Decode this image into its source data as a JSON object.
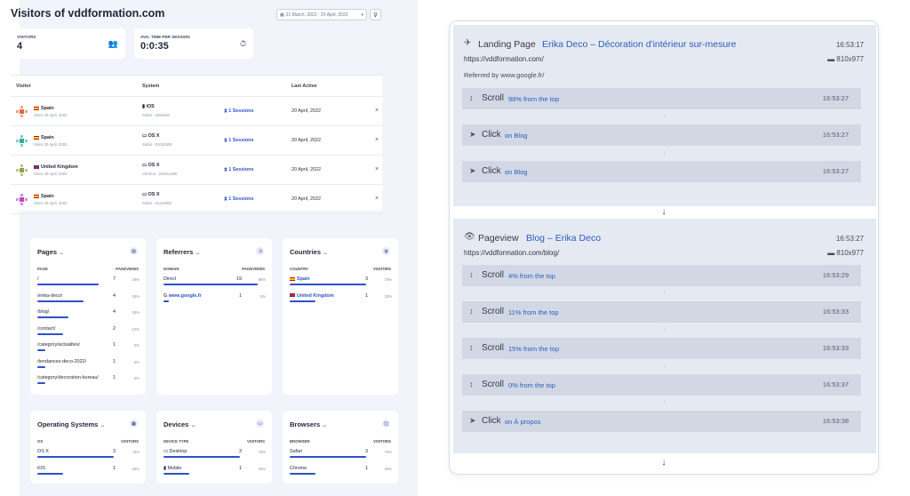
{
  "dashboard": {
    "title": "Visitors of vddformation.com",
    "date_range": "21 March, 2022 - 20 April, 2022",
    "stats": [
      {
        "label": "VISITORS",
        "value": "4",
        "icon": "users-icon"
      },
      {
        "label": "AVG. TIME PER SESSION",
        "value": "0:0:35",
        "icon": "stopwatch-icon"
      }
    ],
    "table": {
      "headers": [
        "Visitor",
        "System",
        "Last Active"
      ],
      "rows": [
        {
          "country": "Spain",
          "since": "Since 20 April, 2022",
          "os": "iOS",
          "browser": "Safari - 428x926",
          "sessions": "1 Sessions",
          "last_active": "20 April, 2022",
          "flag": "es",
          "avatar_color": "#e0673c"
        },
        {
          "country": "Spain",
          "since": "Since 20 April, 2022",
          "os": "OS X",
          "browser": "Safari - 810x1080",
          "sessions": "1 Sessions",
          "last_active": "20 April, 2022",
          "flag": "es",
          "avatar_color": "#2fae9e"
        },
        {
          "country": "United Kingdom",
          "since": "Since 20 April, 2022",
          "os": "OS X",
          "browser": "Chrome - 2240x1260",
          "sessions": "1 Sessions",
          "last_active": "20 April, 2022",
          "flag": "uk",
          "avatar_color": "#8aa04c"
        },
        {
          "country": "Spain",
          "since": "Since 20 April, 2022",
          "os": "OS X",
          "browser": "Safari - 1512x982",
          "sessions": "1 Sessions",
          "last_active": "20 April, 2022",
          "flag": "es",
          "avatar_color": "#c043c6"
        }
      ]
    },
    "panels": {
      "pages": {
        "title": "Pages",
        "col1": "PAGE",
        "col2": "PAGEVIEWS",
        "rows": [
          {
            "label": "/",
            "count": "7",
            "pct": "25%",
            "fill": 0.6
          },
          {
            "label": "/erika-deco/",
            "count": "4",
            "pct": "25%",
            "fill": 0.45
          },
          {
            "label": "/blog/",
            "count": "4",
            "pct": "25%",
            "fill": 0.3
          },
          {
            "label": "/contact/",
            "count": "2",
            "pct": "10%",
            "fill": 0.25
          },
          {
            "label": "/category/actualites/",
            "count": "1",
            "pct": "5%",
            "fill": 0.08
          },
          {
            "label": "/tendances-deco-2022/",
            "count": "1",
            "pct": "5%",
            "fill": 0.08
          },
          {
            "label": "/category/decoration-bureau/",
            "count": "1",
            "pct": "5%",
            "fill": 0.08
          }
        ]
      },
      "referrers": {
        "title": "Referrers",
        "col1": "DOMAIN",
        "col2": "PAGEVIEWS",
        "rows": [
          {
            "label": "Direct",
            "count": "19",
            "pct": "95%",
            "fill": 0.92
          },
          {
            "label": "www.google.fr",
            "count": "1",
            "pct": "5%",
            "fill": 0.05
          }
        ]
      },
      "countries": {
        "title": "Countries",
        "col1": "COUNTRY",
        "col2": "VISITORS",
        "rows": [
          {
            "label": "Spain",
            "count": "3",
            "pct": "75%",
            "fill": 0.75
          },
          {
            "label": "United Kingdom",
            "count": "1",
            "pct": "25%",
            "fill": 0.25
          }
        ]
      },
      "os": {
        "title": "Operating Systems",
        "col1": "OS",
        "col2": "VISITORS",
        "rows": [
          {
            "label": "OS X",
            "count": "3",
            "pct": "75%",
            "fill": 0.75
          },
          {
            "label": "iOS",
            "count": "1",
            "pct": "25%",
            "fill": 0.25
          }
        ]
      },
      "devices": {
        "title": "Devices",
        "col1": "DEVICE TYPE",
        "col2": "VISITORS",
        "rows": [
          {
            "label": "Desktop",
            "count": "3",
            "pct": "75%",
            "fill": 0.75
          },
          {
            "label": "Mobile",
            "count": "1",
            "pct": "25%",
            "fill": 0.25
          }
        ]
      },
      "browsers": {
        "title": "Browsers",
        "col1": "BROWSER",
        "col2": "VISITORS",
        "rows": [
          {
            "label": "Safari",
            "count": "3",
            "pct": "75%",
            "fill": 0.75
          },
          {
            "label": "Chrome",
            "count": "1",
            "pct": "25%",
            "fill": 0.25
          }
        ]
      }
    }
  },
  "journey": {
    "sessions": [
      {
        "type": "Landing Page",
        "title": "Erika Deco – Décoration d'intérieur sur-mesure",
        "time": "16:53:17",
        "url": "https://vddformation.com/",
        "resolution": "810x977",
        "referrer": "Referred by www.google.fr/",
        "events": [
          {
            "type": "Scroll",
            "detail": "98% from the top",
            "time": "16:53:27"
          },
          {
            "type": "Click",
            "detail": "on Blog",
            "time": "16:53:27"
          },
          {
            "type": "Click",
            "detail": "on Blog",
            "time": "16:53:27"
          }
        ]
      },
      {
        "type": "Pageview",
        "title": "Blog – Erika Deco",
        "time": "16:53:27",
        "url": "https://vddformation.com/blog/",
        "resolution": "810x977",
        "events": [
          {
            "type": "Scroll",
            "detail": "4% from the top",
            "time": "16:53:29"
          },
          {
            "type": "Scroll",
            "detail": "11% from the top",
            "time": "16:53:33"
          },
          {
            "type": "Scroll",
            "detail": "15% from the top",
            "time": "16:53:33"
          },
          {
            "type": "Scroll",
            "detail": "0% from the top",
            "time": "16:53:37"
          },
          {
            "type": "Click",
            "detail": "on À propos",
            "time": "16:53:38"
          }
        ]
      }
    ]
  }
}
